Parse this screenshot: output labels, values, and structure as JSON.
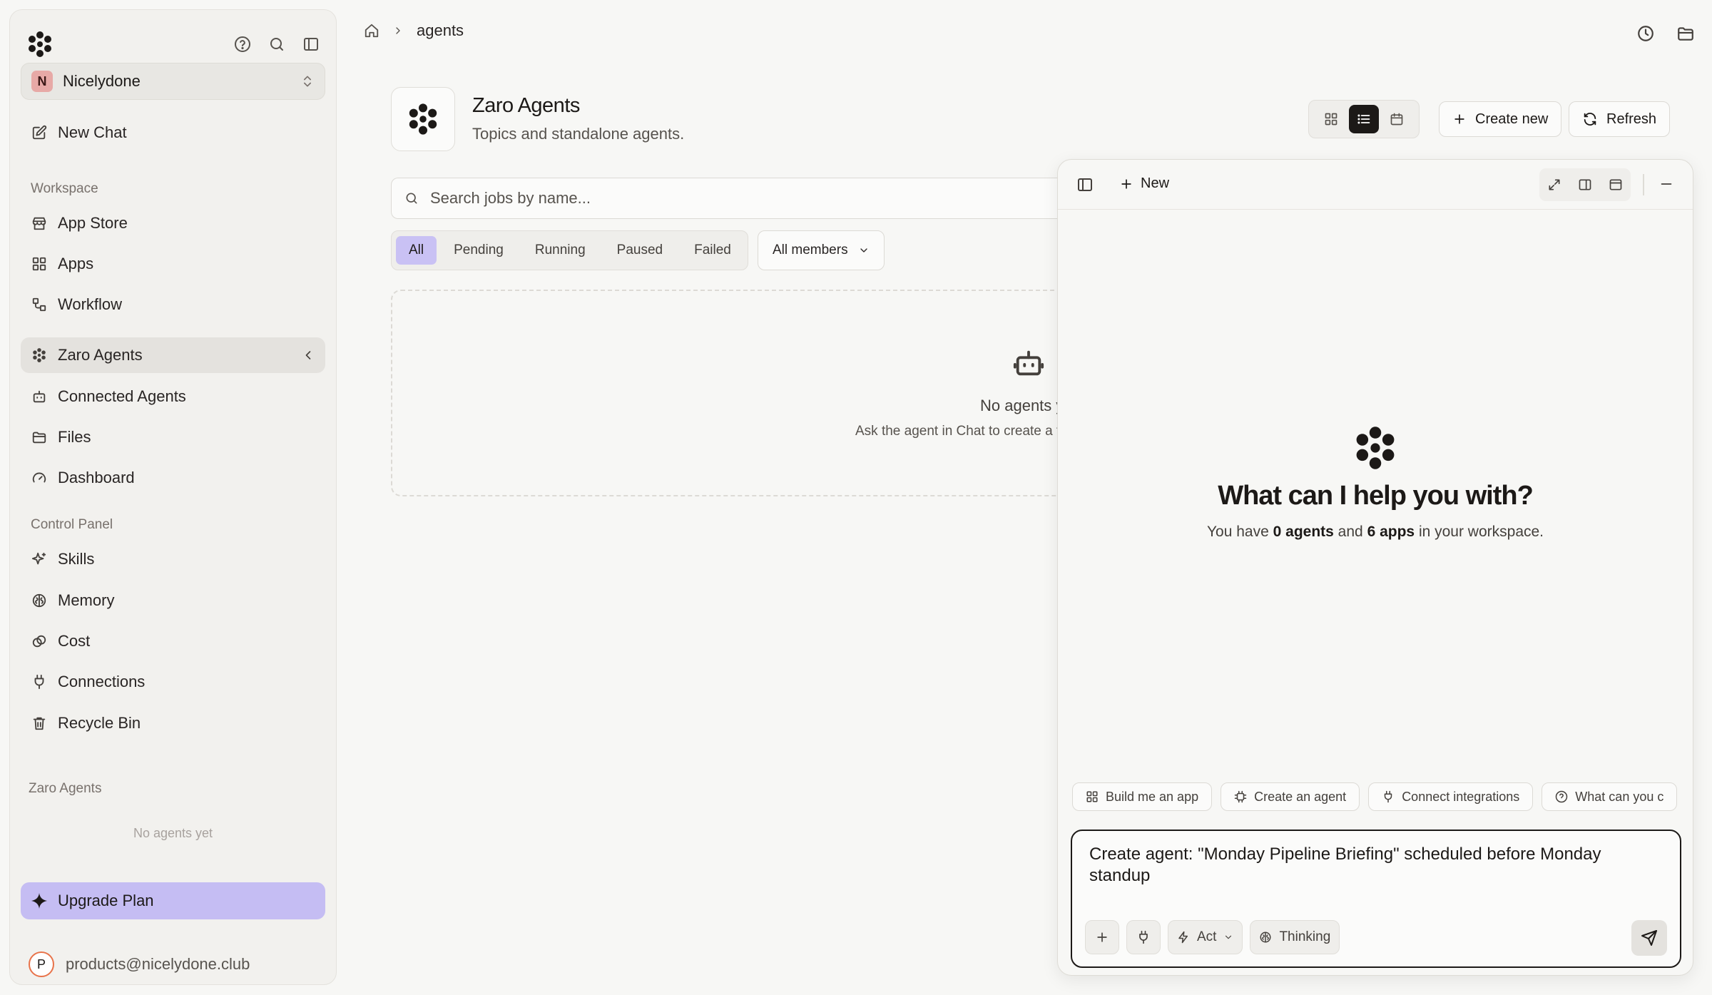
{
  "sidebar": {
    "workspace_initial": "N",
    "workspace_name": "Nicelydone",
    "new_chat": "New Chat",
    "sections": {
      "workspace": "Workspace",
      "control_panel": "Control Panel",
      "agents": "Zaro Agents"
    },
    "workspace_items": [
      "App Store",
      "Apps",
      "Workflow",
      "Zaro Agents",
      "Connected Agents",
      "Files",
      "Dashboard"
    ],
    "control_items": [
      "Skills",
      "Memory",
      "Cost",
      "Connections",
      "Recycle Bin"
    ],
    "no_agents": "No agents yet",
    "upgrade": "Upgrade Plan",
    "user_initial": "P",
    "user_email": "products@nicelydone.club"
  },
  "breadcrumb": {
    "current": "agents"
  },
  "page": {
    "title": "Zaro Agents",
    "subtitle": "Topics and standalone agents.",
    "create_label": "Create new",
    "refresh_label": "Refresh",
    "search_placeholder": "Search jobs by name...",
    "filters": [
      "All",
      "Pending",
      "Running",
      "Paused",
      "Failed"
    ],
    "members_label": "All members",
    "empty_title": "No agents y",
    "empty_sub": "Ask the agent in Chat to create a t"
  },
  "chat": {
    "new_label": "New",
    "heading": "What can I help you with?",
    "sub": {
      "prefix": "You have",
      "agents": "0 agents",
      "and": "and",
      "apps": "6 apps",
      "suffix": "in your workspace."
    },
    "chips": [
      "Build me an app",
      "Create an agent",
      "Connect integrations",
      "What can you c"
    ],
    "composer_text": "Create agent: \"Monday Pipeline Briefing\" scheduled before Monday standup",
    "mode_label": "Act",
    "thinking_label": "Thinking"
  },
  "colors": {
    "accent": "#c5bdf3",
    "text": "#1c1917",
    "background": "#f7f7f5"
  }
}
